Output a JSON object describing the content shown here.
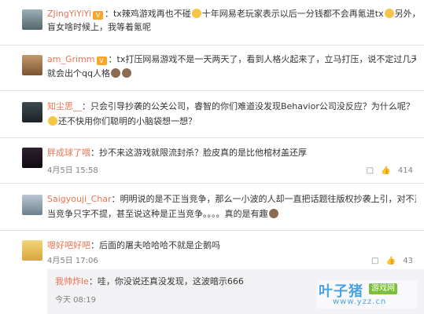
{
  "comments": [
    {
      "username": "ZJingYiYiYi",
      "text1": "：tx辣鸡游戏再也不碰",
      "text1b": "十年网易老玩家表示以后一分钱都不会再氪进tx",
      "text1c": "另外，",
      "text2": "盲女啥时候上，我等着氪呢"
    },
    {
      "username": "am_Grimm",
      "text1": "：tx打压网易游戏不是一天两天了，看到人格火起来了，立马打压，说不定过几天",
      "text2": "就会出个qq人格"
    },
    {
      "username": "知尘思__",
      "text1": "：只会引导抄袭的公关公司，睿智的你们难道没发现Behavior公司没反应？为什么呢？",
      "text2": "还不快用你们聪明的小脑袋想一想？"
    },
    {
      "username": "胖成球了喂",
      "text1": "：抄不来这游戏就限流封杀？脸皮真的是比他棺材盖还厚",
      "date": "4月5日 15:58",
      "likes": "414"
    },
    {
      "username": "Saigyouji_Char",
      "text1": "：明明说的是不正当竞争，那么一小波的人却一直把话题往版权抄袭上引，对不正",
      "text2": "当竞争只字不提，甚至说这种是正当竞争。。。。真的是有趣"
    },
    {
      "username": "嗯好吧好吧",
      "text1": "：后面的屠夫哈哈哈不就是企鹅吗",
      "date": "4月5日 17:06",
      "likes": "43"
    }
  ],
  "reply": {
    "username": "我帅炸le",
    "text": "：哇，你没说还真没发现，这波暗示666",
    "time": "今天 08:19"
  },
  "actions": {
    "reply_icon": "reply-icon",
    "like_icon": "thumbs-up-icon"
  },
  "watermark": {
    "brand": "叶子猪",
    "tag": "游戏网",
    "url": "www.yzz.cn"
  },
  "colors": {
    "username": "#eb7350",
    "meta": "#808080",
    "reply_bg": "#f2f2f5"
  }
}
